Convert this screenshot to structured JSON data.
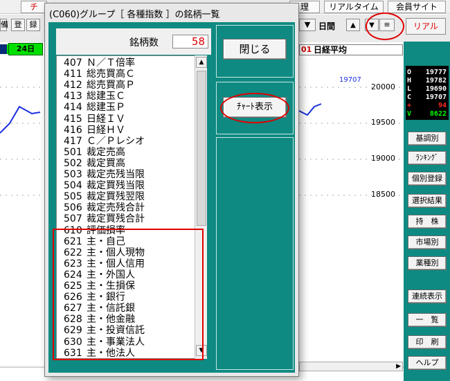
{
  "menubar": {
    "tab_chart_partial": "チ",
    "tab_kanri": "理",
    "tab_realtime": "リアルタイム",
    "tab_member_site": "会員サイト"
  },
  "toolbar": {
    "btn_partial_left": "備",
    "btn_register": "登",
    "btn_record": "録",
    "period_label": "日間",
    "up_icon": "up-triangle",
    "down_icon": "down-triangle",
    "menu_icon": "hamburger",
    "realtime_btn": "リアル",
    "date_label": "24日",
    "symbol_code_fragment": "01",
    "symbol_name": "日経平均"
  },
  "chart": {
    "y_ticks": [
      "20000",
      "19500",
      "19000",
      "18500"
    ],
    "last_price_label": "19707",
    "line_color": "#1a2ee0"
  },
  "quote_panel": {
    "rows": [
      {
        "key": "O",
        "value": "19777",
        "color": "#ffffff"
      },
      {
        "key": "H",
        "value": "19782",
        "color": "#ffffff"
      },
      {
        "key": "L",
        "value": "19690",
        "color": "#ffffff"
      },
      {
        "key": "C",
        "value": "19707",
        "color": "#ffffff"
      },
      {
        "key": "+",
        "value": "94",
        "color": "#ff2a2a"
      },
      {
        "key": "V",
        "value": "8622",
        "color": "#00ff00"
      }
    ]
  },
  "right_buttons": [
    "基調別",
    "ﾗﾝｷﾝｸﾞ",
    "個別登録",
    "選択結果",
    "持　株",
    "市場別",
    "業種別",
    "連続表示",
    "一　覧",
    "印　刷",
    "ヘルプ"
  ],
  "dialog": {
    "title": "(C060)グループ［ 各種指数 ］の銘柄一覧",
    "count_label": "銘柄数",
    "count_value": "58",
    "close_button": "閉じる",
    "chart_button": "ﾁｬｰﾄ表示",
    "items": [
      {
        "code": "407",
        "name": "Ｎ／Ｔ倍率"
      },
      {
        "code": "411",
        "name": "総売買高Ｃ"
      },
      {
        "code": "412",
        "name": "総売買高Ｐ"
      },
      {
        "code": "413",
        "name": "総建玉Ｃ"
      },
      {
        "code": "414",
        "name": "総建玉Ｐ"
      },
      {
        "code": "415",
        "name": "日経ＩＶ"
      },
      {
        "code": "416",
        "name": "日経ＨＶ"
      },
      {
        "code": "417",
        "name": "Ｃ／Ｐレシオ"
      },
      {
        "code": "501",
        "name": "裁定売高"
      },
      {
        "code": "502",
        "name": "裁定買高"
      },
      {
        "code": "503",
        "name": "裁定売残当限"
      },
      {
        "code": "504",
        "name": "裁定買残当限"
      },
      {
        "code": "505",
        "name": "裁定買残翌限"
      },
      {
        "code": "506",
        "name": "裁定売残合計"
      },
      {
        "code": "507",
        "name": "裁定買残合計"
      },
      {
        "code": "610",
        "name": "評価損率"
      },
      {
        "code": "621",
        "name": "主・自己"
      },
      {
        "code": "622",
        "name": "主・個人現物"
      },
      {
        "code": "623",
        "name": "主・個人信用"
      },
      {
        "code": "624",
        "name": "主・外国人"
      },
      {
        "code": "625",
        "name": "主・生損保"
      },
      {
        "code": "626",
        "name": "主・銀行"
      },
      {
        "code": "627",
        "name": "主・信託銀"
      },
      {
        "code": "628",
        "name": "主・他金融"
      },
      {
        "code": "629",
        "name": "主・投資信託"
      },
      {
        "code": "630",
        "name": "主・事業法人"
      },
      {
        "code": "631",
        "name": "主・他法人"
      }
    ]
  },
  "annotations": {
    "color": "#e00000"
  }
}
